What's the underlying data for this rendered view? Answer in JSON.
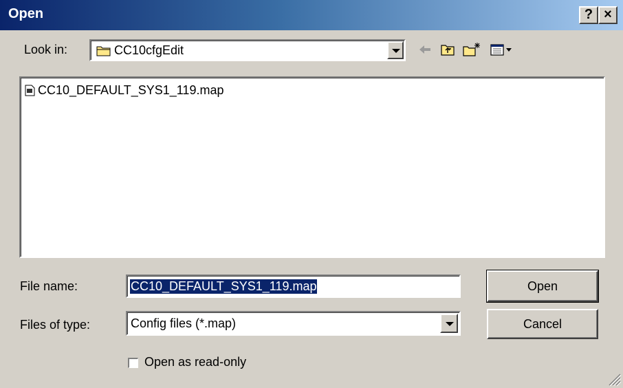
{
  "window": {
    "title": "Open",
    "help_label": "?",
    "close_label": "×"
  },
  "lookin": {
    "label": "Look in:",
    "value": "CC10cfgEdit",
    "icon": "folder-icon"
  },
  "toolbar": {
    "icons": [
      "back-arrow-icon",
      "up-folder-icon",
      "new-folder-icon",
      "view-menu-icon"
    ]
  },
  "files": [
    {
      "name": "CC10_DEFAULT_SYS1_119.map",
      "icon": "file-icon"
    }
  ],
  "form": {
    "filename_label": "File name:",
    "filename_value": "CC10_DEFAULT_SYS1_119.map",
    "filetype_label": "Files of type:",
    "filetype_value": "Config files (*.map)",
    "readonly_label": "Open as read-only",
    "readonly_checked": false
  },
  "buttons": {
    "open": "Open",
    "cancel": "Cancel"
  },
  "colors": {
    "title_start": "#0a246a",
    "title_end": "#a6caf0",
    "face": "#d4d0c8",
    "selection": "#0a246a"
  }
}
